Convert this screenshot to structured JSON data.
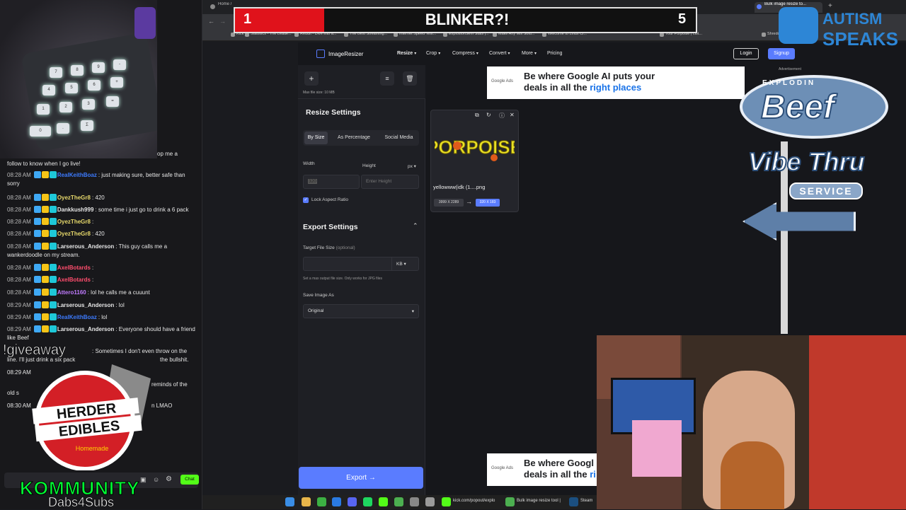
{
  "browser": {
    "tabs": [
      "Home /",
      "Bulk image resize to..."
    ],
    "bookmarks": [
      "Kick",
      "Statistics - The Leade...",
      "Reddit - Dive into a...",
      "The Best Streaming...",
      "Internet Speed Test...",
      "ExplosionSem Stats |...",
      "Make Any Mix Solu...",
      "Welcome to Linux Cl...",
      "Your Porpoise | clot...",
      "Shredder Gri..."
    ]
  },
  "overlay": {
    "score_left": "1",
    "title": "BLINKER?!",
    "score_right": "5",
    "autism_line1": "AUTISM",
    "autism_line2": "SPEAKS",
    "beef_top": "EXPLODIN",
    "beef_main": "Beef",
    "vibe": "Vibe Thru",
    "service": "SERVICE",
    "giveaway": "!giveaway",
    "herder_line1": "HERDER",
    "herder_line2": "EDIBLES",
    "herder_sub": "Homemade",
    "community": "KOMMUNITY",
    "dabs": "Dabs4Subs"
  },
  "chat": {
    "top_fragment": "op me a",
    "first_line": "follow to know when I go live!",
    "messages": [
      {
        "ts": "08:28 AM",
        "user": "RealKeithBoaz",
        "color": "#3d7bff",
        "text": ": just making sure, better safe than sorry"
      },
      {
        "ts": "08:28 AM",
        "user": "OyezTheGr8",
        "color": "#e6d86b",
        "text": ": 420"
      },
      {
        "ts": "08:28 AM",
        "user": "Dankkush999",
        "color": "#e6e6e6",
        "text": ": some time i just go to drink a 6 pack"
      },
      {
        "ts": "08:28 AM",
        "user": "OyezTheGr8",
        "color": "#e6d86b",
        "text": ":"
      },
      {
        "ts": "08:28 AM",
        "user": "OyezTheGr8",
        "color": "#e6d86b",
        "text": ": 420"
      },
      {
        "ts": "08:28 AM",
        "user": "Larserous_Anderson",
        "color": "#e6e6e6",
        "text": ": This guy calls me a wankerdoodle on my stream."
      },
      {
        "ts": "08:28 AM",
        "user": "AxelBotards",
        "color": "#ff4d6d",
        "text": ":"
      },
      {
        "ts": "08:28 AM",
        "user": "AxelBotards",
        "color": "#ff4d6d",
        "text": ":"
      },
      {
        "ts": "08:28 AM",
        "user": "Attero1160",
        "color": "#c07bff",
        "text": ": lol he calls me a cuuunt"
      },
      {
        "ts": "08:29 AM",
        "user": "Larserous_Anderson",
        "color": "#e6e6e6",
        "text": ": lol"
      },
      {
        "ts": "08:29 AM",
        "user": "RealKeithBoaz",
        "color": "#3d7bff",
        "text": ": lol"
      },
      {
        "ts": "08:29 AM",
        "user": "Larserous_Anderson",
        "color": "#e6e6e6",
        "text": ": Everyone should have a friend like Beef"
      }
    ],
    "partial": [
      {
        "text": ": Sometimes I don't even throw on the"
      },
      {
        "text": "line. I'll just drink a six pack"
      },
      {
        "text": "the bullshit."
      },
      {
        "text": "08:29 AM"
      },
      {
        "text": "reminds of the"
      },
      {
        "text": "old s"
      },
      {
        "text": "08:30 AM"
      },
      {
        "text": "n LMAO"
      }
    ],
    "chat_button": "Chat"
  },
  "app": {
    "logo": "ImageResizer",
    "nav": [
      "Resize",
      "Crop",
      "Compress",
      "Convert",
      "More",
      "Pricing"
    ],
    "login": "Login",
    "signup": "Signup",
    "max_file_size": "Max file size: 10 MB",
    "resize_settings": "Resize Settings",
    "tabs": [
      "By Size",
      "As Percentage",
      "Social Media"
    ],
    "width_label": "Width",
    "height_label": "Height",
    "unit": "px",
    "width_value": "320",
    "height_placeholder": "Enter Height",
    "lock_aspect": "Lock Aspect Ratio",
    "export_settings": "Export Settings",
    "target_size_label": "Target File Size",
    "optional": "(optional)",
    "size_unit": "KB",
    "target_hint": "Set a max output file size. Only works for JPG files",
    "save_as_label": "Save Image As",
    "save_as_value": "Original",
    "export_button": "Export",
    "file": {
      "name": "yellowww(idk (1....png",
      "from": "3999 X 2289",
      "to": "320 X 183",
      "image_text": "PORPOISE"
    },
    "ad": {
      "advertisement": "Advertisement",
      "google": "Google Ads",
      "line1": "Be where Google AI puts your",
      "line2_a": "deals in all the ",
      "line2_b": "right places",
      "ad2_line1": "Be where Googl",
      "ad2_line2_a": "deals in all the ",
      "ad2_line2_b": "ri"
    }
  },
  "taskbar": {
    "items": [
      "kick.com/popout/explo",
      "Bulk image resize tool |",
      "Steam"
    ]
  }
}
